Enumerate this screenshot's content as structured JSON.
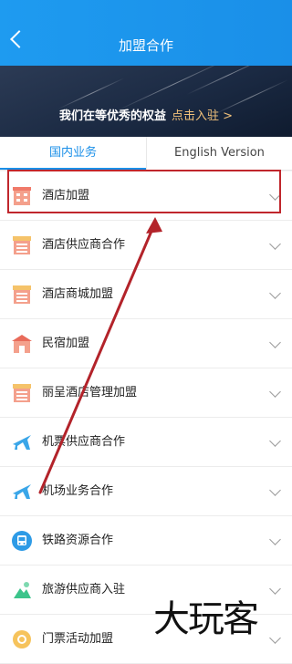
{
  "header": {
    "title": "加盟合作",
    "back_icon": "chevron-left-icon"
  },
  "banner": {
    "text": "我们在等优秀的权益",
    "link": "点击入驻 >"
  },
  "tabs": [
    {
      "label": "国内业务",
      "active": true
    },
    {
      "label": "English Version",
      "active": false
    }
  ],
  "items": [
    {
      "label": "酒店加盟",
      "icon": "hotel-icon"
    },
    {
      "label": "酒店供应商合作",
      "icon": "supplier-icon"
    },
    {
      "label": "酒店商城加盟",
      "icon": "mall-icon"
    },
    {
      "label": "民宿加盟",
      "icon": "homestay-icon"
    },
    {
      "label": "丽呈酒店管理加盟",
      "icon": "hotel-management-icon"
    },
    {
      "label": "机票供应商合作",
      "icon": "plane-icon"
    },
    {
      "label": "机场业务合作",
      "icon": "airport-icon"
    },
    {
      "label": "铁路资源合作",
      "icon": "train-icon"
    },
    {
      "label": "旅游供应商入驻",
      "icon": "travel-icon"
    },
    {
      "label": "门票活动加盟",
      "icon": "ticket-icon"
    }
  ],
  "watermark": "大玩客",
  "colors": {
    "accent": "#1a8fe8",
    "highlight": "#c0262c",
    "gold": "#f2c27b"
  }
}
